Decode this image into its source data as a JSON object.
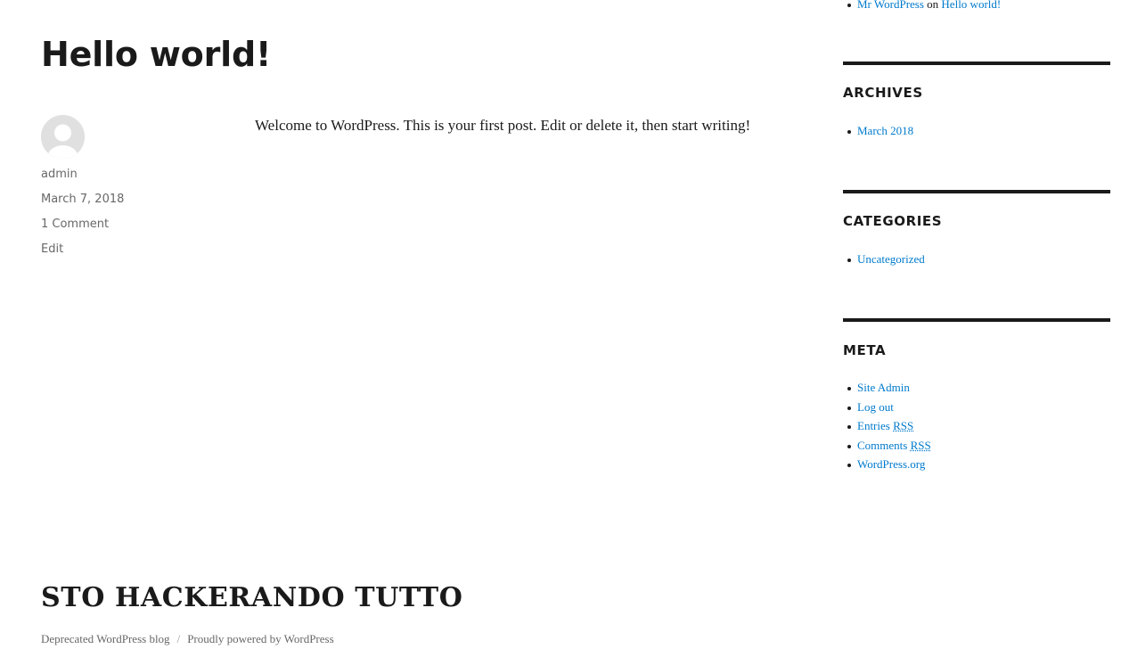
{
  "post": {
    "title": "Hello world!",
    "author": "admin",
    "date": "March 7, 2018",
    "comments_link": "1 Comment",
    "edit_link": "Edit",
    "content": "Welcome to WordPress. This is your first post. Edit or delete it, then start writing!"
  },
  "sidebar": {
    "recent_comment": {
      "author": "Mr WordPress",
      "on": "on",
      "post": "Hello world!"
    },
    "archives": {
      "title": "ARCHIVES",
      "items": [
        "March 2018"
      ]
    },
    "categories": {
      "title": "CATEGORIES",
      "items": [
        "Uncategorized"
      ]
    },
    "meta": {
      "title": "META",
      "items": [
        {
          "label": "Site Admin"
        },
        {
          "label": "Log out"
        },
        {
          "label": "Entries",
          "abbr": "RSS"
        },
        {
          "label": "Comments",
          "abbr": "RSS"
        },
        {
          "label": "WordPress.org"
        }
      ]
    }
  },
  "footer": {
    "site_title": "STO HACKERANDO TUTTO",
    "blog_link": "Deprecated WordPress blog",
    "separator": "/",
    "powered_by": "Proudly powered by WordPress"
  },
  "colors": {
    "link": "#007acc",
    "text": "#1a1a1a",
    "muted": "#686868"
  }
}
